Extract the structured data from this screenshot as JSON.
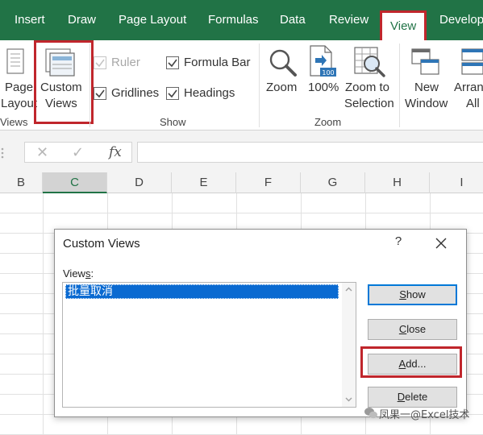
{
  "tabs": [
    {
      "id": "insert",
      "label": "Insert"
    },
    {
      "id": "draw",
      "label": "Draw"
    },
    {
      "id": "page-layout",
      "label": "Page Layout"
    },
    {
      "id": "formulas",
      "label": "Formulas"
    },
    {
      "id": "data",
      "label": "Data"
    },
    {
      "id": "review",
      "label": "Review"
    },
    {
      "id": "view",
      "label": "View",
      "active": true
    },
    {
      "id": "developer",
      "label": "Develop"
    }
  ],
  "ribbon": {
    "workbook_views": {
      "page_layout_line1": "Page",
      "page_layout_line2": "Layout",
      "custom_views_line1": "Custom",
      "custom_views_line2": "Views",
      "group_label": "Views"
    },
    "show": {
      "ruler": {
        "label": "Ruler",
        "checked": true,
        "disabled": true
      },
      "formula_bar": {
        "label": "Formula Bar",
        "checked": true
      },
      "gridlines": {
        "label": "Gridlines",
        "checked": true
      },
      "headings": {
        "label": "Headings",
        "checked": true
      },
      "group_label": "Show"
    },
    "zoom": {
      "zoom_label": "Zoom",
      "hundred_label": "100%",
      "hundred_icon_text": "100",
      "zoom_to_selection_line1": "Zoom to",
      "zoom_to_selection_line2": "Selection",
      "group_label": "Zoom"
    },
    "window": {
      "new_window_line1": "New",
      "new_window_line2": "Window",
      "arrange_line1": "Arran",
      "arrange_line2": "All"
    }
  },
  "formula_bar": {
    "cancel_symbol": "✕",
    "enter_symbol": "✓",
    "fx_symbol": "fx",
    "value": ""
  },
  "columns": [
    "B",
    "C",
    "D",
    "E",
    "F",
    "G",
    "H",
    "I"
  ],
  "selected_column": "C",
  "dialog": {
    "title": "Custom Views",
    "help_symbol": "?",
    "views_label_prefix": "View",
    "views_label_accel": "s",
    "views_label_suffix": ":",
    "views": [
      "批量取消"
    ],
    "selected_view_index": 0,
    "buttons": {
      "show": {
        "accel": "S",
        "rest": "how"
      },
      "close": {
        "accel": "C",
        "rest": "lose"
      },
      "add": {
        "accel": "A",
        "rest": "dd..."
      },
      "delete": {
        "accel": "D",
        "rest": "elete"
      }
    }
  },
  "watermark": "凤果一@Excel技术",
  "colors": {
    "ribbon_green": "#217346",
    "highlight_red": "#c0262c",
    "selection_blue": "#0a6ad1",
    "default_button_border": "#0078d7"
  }
}
